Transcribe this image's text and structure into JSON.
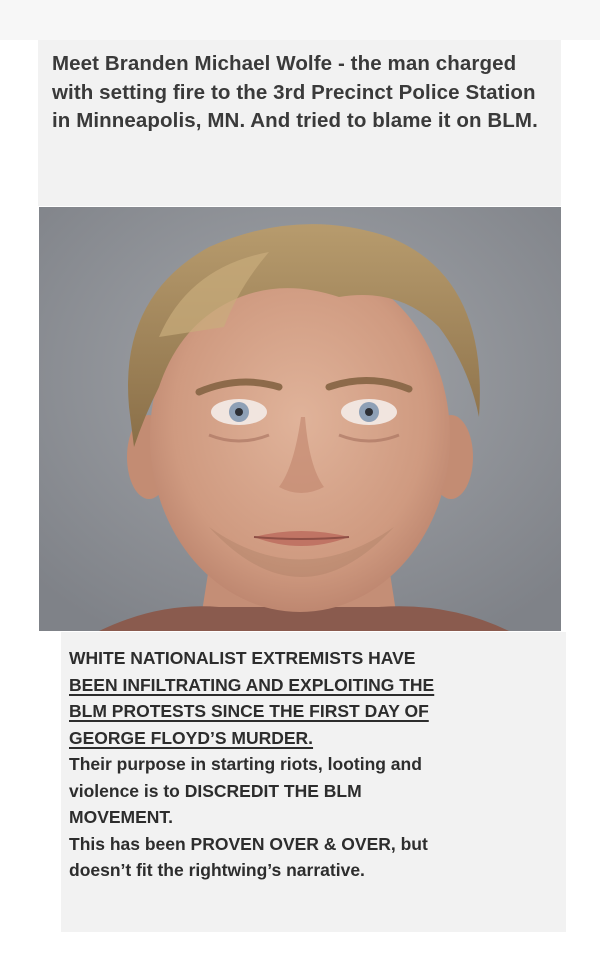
{
  "post": {
    "headline": "Meet Branden Michael Wolfe  - the man charged with setting fire to the 3rd Precinct Police Station in Minneapolis, MN. And tried to blame it on BLM.",
    "photo_description_icon": "mugshot-photo",
    "body_lines": [
      {
        "text": "WHITE NATIONALIST EXTREMISTS HAVE",
        "underline": false
      },
      {
        "text": "BEEN INFILTRATING AND EXPLOITING THE",
        "underline": true
      },
      {
        "text": "BLM PROTESTS SINCE THE FIRST DAY OF",
        "underline": true
      },
      {
        "text": "GEORGE FLOYD’S MURDER.",
        "underline": true
      },
      {
        "text": "Their purpose in starting riots, looting and",
        "underline": false
      },
      {
        "text": "violence is to DISCREDIT THE BLM",
        "underline": false
      },
      {
        "text": "MOVEMENT.",
        "underline": false
      },
      {
        "text": "This has been PROVEN OVER & OVER, but",
        "underline": false
      },
      {
        "text": "doesn’t fit the rightwing’s narrative.",
        "underline": false
      }
    ]
  },
  "colors": {
    "card_background": "#f2f2f2",
    "photo_background": "#8e9197",
    "text": "#2d2d2d"
  }
}
